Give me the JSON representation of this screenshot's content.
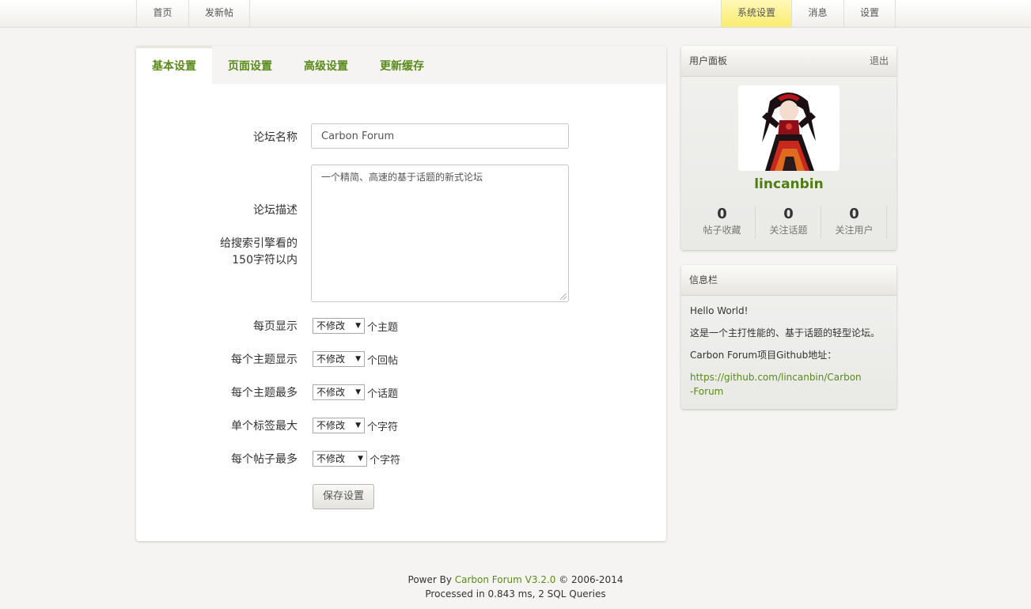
{
  "nav": {
    "left": [
      "首页",
      "发新帖"
    ],
    "right": [
      "系统设置",
      "消息",
      "设置"
    ]
  },
  "tabs": [
    "基本设置",
    "页面设置",
    "高级设置",
    "更新缓存"
  ],
  "form": {
    "forum_name_label": "论坛名称",
    "forum_name_value": "Carbon Forum",
    "desc_label": "论坛描述",
    "desc_hint_1": "给搜索引擎看的",
    "desc_hint_2": "150字符以内",
    "desc_value": "一个精简、高速的基于话题的新式论坛",
    "rows": [
      {
        "label": "每页显示",
        "select": "不修改",
        "suffix": "个主题"
      },
      {
        "label": "每个主题显示",
        "select": "不修改",
        "suffix": "个回帖"
      },
      {
        "label": "每个主题最多",
        "select": "不修改",
        "suffix": "个话题"
      },
      {
        "label": "单个标签最大",
        "select": "不修改",
        "suffix": "个字符"
      },
      {
        "label": "每个帖子最多",
        "select": "不修改",
        "suffix": "个字符"
      }
    ],
    "save_label": "保存设置"
  },
  "user_panel": {
    "title": "用户面板",
    "logout": "退出",
    "username": "lincanbin",
    "stats": [
      {
        "num": "0",
        "label": "帖子收藏"
      },
      {
        "num": "0",
        "label": "关注话题"
      },
      {
        "num": "0",
        "label": "关注用户"
      }
    ]
  },
  "info_panel": {
    "title": "信息栏",
    "line1": "Hello World!",
    "line2": "这是一个主打性能的、基于话题的轻型论坛。",
    "line3": "Carbon Forum项目Github地址：",
    "link": "https://github.com/lincanbin/Carbon-Forum"
  },
  "footer": {
    "prefix": "Power By ",
    "link": "Carbon Forum V3.2.0",
    "suffix": " © 2006-2014",
    "line2": "Processed in 0.843 ms, 2 SQL Queries"
  },
  "colors": {
    "accent_green": "#5a8a1a",
    "active_nav": "#f9ec6e",
    "background": "#f5f4f2"
  }
}
